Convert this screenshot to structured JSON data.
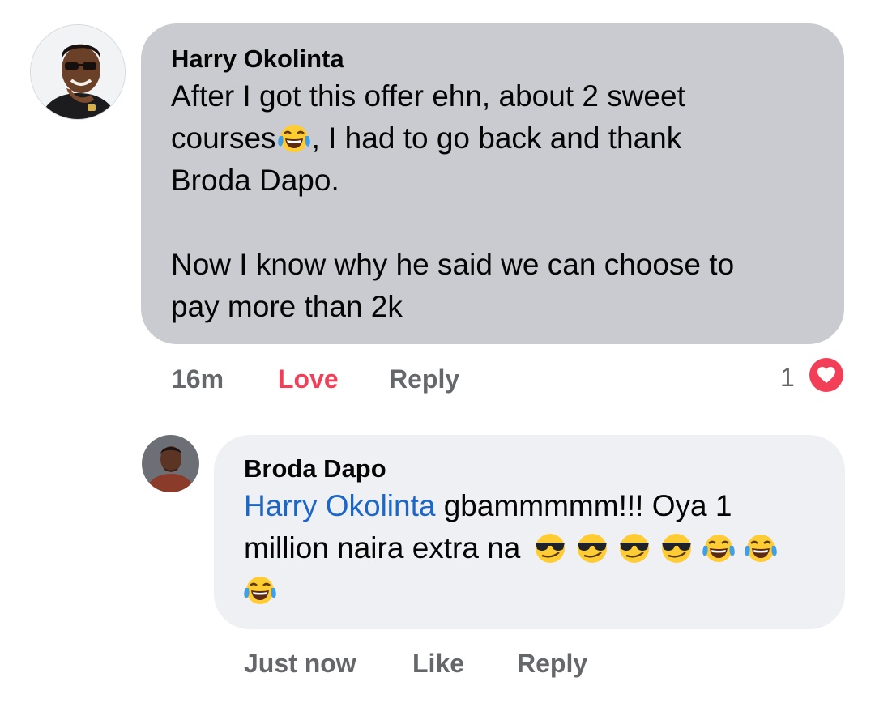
{
  "comment": {
    "author": "Harry Okolinta",
    "text_1": "After I got this offer ehn, about 2 sweet\ncourses",
    "text_2": ", I had to go back and thank\nBroda Dapo.\n\nNow I know why he said we can choose to\npay more than 2k",
    "time": "16m",
    "love_label": "Love",
    "reply_label": "Reply",
    "reaction_count": "1",
    "reaction_type": "heart-icon",
    "colors": {
      "bubble": "#c9cbd1",
      "love": "#f33e58",
      "heart": "#f33e58"
    }
  },
  "reply": {
    "author": "Broda Dapo",
    "mention": "Harry Okolinta",
    "text_1": " gbammmmm!!! Oya 1\nmillion naira extra na ",
    "emojis": [
      "cool-face-emoji",
      "cool-face-emoji",
      "cool-face-emoji",
      "cool-face-emoji",
      "tears-of-joy-emoji",
      "tears-of-joy-emoji",
      "tears-of-joy-emoji"
    ],
    "time": "Just now",
    "like_label": "Like",
    "reply_label": "Reply",
    "colors": {
      "bubble": "#eff0f4",
      "mention": "#1b67c9"
    }
  }
}
